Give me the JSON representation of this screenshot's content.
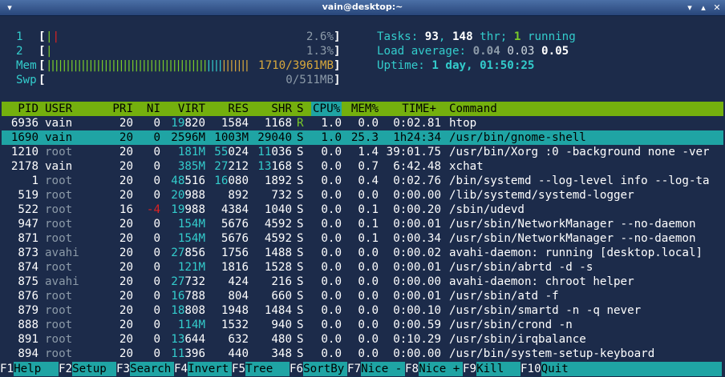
{
  "window": {
    "title": "vain@desktop:~"
  },
  "meters": {
    "cpu1": {
      "label": "1",
      "bar": "||",
      "value": "2.6%"
    },
    "cpu2": {
      "label": "2",
      "bar": "|",
      "value": "1.3%"
    },
    "mem": {
      "label": "Mem",
      "bar": "||||||||||||||||||||||||||||||||||||||||||||||||||||||",
      "value": "1710/3961MB"
    },
    "swp": {
      "label": "Swp",
      "bar": "",
      "value": "0/511MB"
    }
  },
  "summary": {
    "tasks_label": "Tasks:",
    "tasks": "93",
    "threads": "148",
    "thr_label": "thr;",
    "running": "1",
    "running_label": "running",
    "load_label": "Load average:",
    "load1": "0.04",
    "load5": "0.03",
    "load15": "0.05",
    "uptime_label": "Uptime:",
    "uptime": "1 day, 01:50:25"
  },
  "columns": [
    "PID",
    "USER",
    "PRI",
    "NI",
    "VIRT",
    "RES",
    "SHR",
    "S",
    "CPU%",
    "MEM%",
    "TIME+",
    "Command"
  ],
  "processes": [
    {
      "pid": "6936",
      "user": "vain",
      "pri": "20",
      "ni": "0",
      "virt_a": "19",
      "virt_b": "820",
      "res_a": "",
      "res_b": "1584",
      "shr_a": "",
      "shr_b": "1168",
      "s": "R",
      "cpu": "1.0",
      "mem": "0.0",
      "time": "0:02.81",
      "cmd": "htop"
    },
    {
      "pid": "1690",
      "user": "vain",
      "pri": "20",
      "ni": "0",
      "virt_a": "",
      "virt_b": "2596M",
      "res_a": "",
      "res_b": "1003M",
      "shr_a": "",
      "shr_b": "29040",
      "s": "S",
      "cpu": "1.0",
      "mem": "25.3",
      "time": "1h24:34",
      "cmd": "/usr/bin/gnome-shell"
    },
    {
      "pid": "1210",
      "user": "root",
      "pri": "20",
      "ni": "0",
      "virt_a": "",
      "virt_b": "181M",
      "res_a": "55",
      "res_b": "024",
      "shr_a": "11",
      "shr_b": "036",
      "s": "S",
      "cpu": "0.0",
      "mem": "1.4",
      "time": "39:01.75",
      "cmd": "/usr/bin/Xorg :0 -background none -ver"
    },
    {
      "pid": "2178",
      "user": "vain",
      "pri": "20",
      "ni": "0",
      "virt_a": "",
      "virt_b": "385M",
      "res_a": "27",
      "res_b": "212",
      "shr_a": "13",
      "shr_b": "168",
      "s": "S",
      "cpu": "0.0",
      "mem": "0.7",
      "time": "6:42.48",
      "cmd": "xchat"
    },
    {
      "pid": "1",
      "user": "root",
      "pri": "20",
      "ni": "0",
      "virt_a": "48",
      "virt_b": "516",
      "res_a": "16",
      "res_b": "080",
      "shr_a": "",
      "shr_b": "1892",
      "s": "S",
      "cpu": "0.0",
      "mem": "0.4",
      "time": "0:02.76",
      "cmd": "/bin/systemd --log-level info --log-ta"
    },
    {
      "pid": "519",
      "user": "root",
      "pri": "20",
      "ni": "0",
      "virt_a": "20",
      "virt_b": "988",
      "res_a": "",
      "res_b": "892",
      "shr_a": "",
      "shr_b": "732",
      "s": "S",
      "cpu": "0.0",
      "mem": "0.0",
      "time": "0:00.00",
      "cmd": "/lib/systemd/systemd-logger"
    },
    {
      "pid": "522",
      "user": "root",
      "pri": "16",
      "ni": "-4",
      "virt_a": "19",
      "virt_b": "988",
      "res_a": "",
      "res_b": "4384",
      "shr_a": "",
      "shr_b": "1040",
      "s": "S",
      "cpu": "0.0",
      "mem": "0.1",
      "time": "0:00.20",
      "cmd": "/sbin/udevd"
    },
    {
      "pid": "947",
      "user": "root",
      "pri": "20",
      "ni": "0",
      "virt_a": "",
      "virt_b": "154M",
      "res_a": "",
      "res_b": "5676",
      "shr_a": "",
      "shr_b": "4592",
      "s": "S",
      "cpu": "0.0",
      "mem": "0.1",
      "time": "0:00.01",
      "cmd": "/usr/sbin/NetworkManager --no-daemon"
    },
    {
      "pid": "871",
      "user": "root",
      "pri": "20",
      "ni": "0",
      "virt_a": "",
      "virt_b": "154M",
      "res_a": "",
      "res_b": "5676",
      "shr_a": "",
      "shr_b": "4592",
      "s": "S",
      "cpu": "0.0",
      "mem": "0.1",
      "time": "0:00.34",
      "cmd": "/usr/sbin/NetworkManager --no-daemon"
    },
    {
      "pid": "873",
      "user": "avahi",
      "pri": "20",
      "ni": "0",
      "virt_a": "27",
      "virt_b": "856",
      "res_a": "",
      "res_b": "1756",
      "shr_a": "",
      "shr_b": "1488",
      "s": "S",
      "cpu": "0.0",
      "mem": "0.0",
      "time": "0:00.02",
      "cmd": "avahi-daemon: running [desktop.local]"
    },
    {
      "pid": "874",
      "user": "root",
      "pri": "20",
      "ni": "0",
      "virt_a": "",
      "virt_b": "121M",
      "res_a": "",
      "res_b": "1816",
      "shr_a": "",
      "shr_b": "1528",
      "s": "S",
      "cpu": "0.0",
      "mem": "0.0",
      "time": "0:00.01",
      "cmd": "/usr/sbin/abrtd -d -s"
    },
    {
      "pid": "875",
      "user": "avahi",
      "pri": "20",
      "ni": "0",
      "virt_a": "27",
      "virt_b": "732",
      "res_a": "",
      "res_b": "424",
      "shr_a": "",
      "shr_b": "216",
      "s": "S",
      "cpu": "0.0",
      "mem": "0.0",
      "time": "0:00.00",
      "cmd": "avahi-daemon: chroot helper"
    },
    {
      "pid": "876",
      "user": "root",
      "pri": "20",
      "ni": "0",
      "virt_a": "16",
      "virt_b": "788",
      "res_a": "",
      "res_b": "804",
      "shr_a": "",
      "shr_b": "660",
      "s": "S",
      "cpu": "0.0",
      "mem": "0.0",
      "time": "0:00.01",
      "cmd": "/usr/sbin/atd -f"
    },
    {
      "pid": "879",
      "user": "root",
      "pri": "20",
      "ni": "0",
      "virt_a": "18",
      "virt_b": "808",
      "res_a": "",
      "res_b": "1948",
      "shr_a": "",
      "shr_b": "1484",
      "s": "S",
      "cpu": "0.0",
      "mem": "0.0",
      "time": "0:00.10",
      "cmd": "/usr/sbin/smartd -n -q never"
    },
    {
      "pid": "888",
      "user": "root",
      "pri": "20",
      "ni": "0",
      "virt_a": "",
      "virt_b": "114M",
      "res_a": "",
      "res_b": "1532",
      "shr_a": "",
      "shr_b": "940",
      "s": "S",
      "cpu": "0.0",
      "mem": "0.0",
      "time": "0:00.59",
      "cmd": "/usr/sbin/crond -n"
    },
    {
      "pid": "891",
      "user": "root",
      "pri": "20",
      "ni": "0",
      "virt_a": "13",
      "virt_b": "644",
      "res_a": "",
      "res_b": "632",
      "shr_a": "",
      "shr_b": "480",
      "s": "S",
      "cpu": "0.0",
      "mem": "0.0",
      "time": "0:10.29",
      "cmd": "/usr/sbin/irqbalance"
    },
    {
      "pid": "894",
      "user": "root",
      "pri": "20",
      "ni": "0",
      "virt_a": "11",
      "virt_b": "396",
      "res_a": "",
      "res_b": "440",
      "shr_a": "",
      "shr_b": "348",
      "s": "S",
      "cpu": "0.0",
      "mem": "0.0",
      "time": "0:00.00",
      "cmd": "/usr/bin/system-setup-keyboard"
    }
  ],
  "selected_index": 1,
  "function_keys": [
    {
      "key": "F1",
      "label": "Help"
    },
    {
      "key": "F2",
      "label": "Setup"
    },
    {
      "key": "F3",
      "label": "Search"
    },
    {
      "key": "F4",
      "label": "Invert"
    },
    {
      "key": "F5",
      "label": "Tree"
    },
    {
      "key": "F6",
      "label": "SortBy"
    },
    {
      "key": "F7",
      "label": "Nice -"
    },
    {
      "key": "F8",
      "label": "Nice +"
    },
    {
      "key": "F9",
      "label": "Kill"
    },
    {
      "key": "F10",
      "label": "Quit"
    }
  ],
  "colors": {
    "background": "#1c2b4a",
    "header_bg": "#74b00e",
    "selection_bg": "#1fa4a4",
    "cyan": "#33cccc",
    "green": "#7acb29",
    "red": "#dd2222",
    "gray": "#8c9aa8"
  }
}
